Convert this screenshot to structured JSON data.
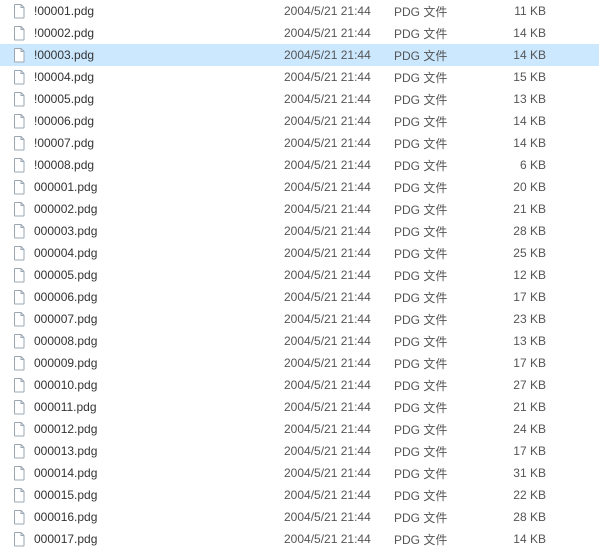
{
  "selectedIndex": 2,
  "files": [
    {
      "name": "!00001.pdg",
      "date": "2004/5/21 21:44",
      "type": "PDG 文件",
      "size": "11 KB"
    },
    {
      "name": "!00002.pdg",
      "date": "2004/5/21 21:44",
      "type": "PDG 文件",
      "size": "14 KB"
    },
    {
      "name": "!00003.pdg",
      "date": "2004/5/21 21:44",
      "type": "PDG 文件",
      "size": "14 KB"
    },
    {
      "name": "!00004.pdg",
      "date": "2004/5/21 21:44",
      "type": "PDG 文件",
      "size": "15 KB"
    },
    {
      "name": "!00005.pdg",
      "date": "2004/5/21 21:44",
      "type": "PDG 文件",
      "size": "13 KB"
    },
    {
      "name": "!00006.pdg",
      "date": "2004/5/21 21:44",
      "type": "PDG 文件",
      "size": "14 KB"
    },
    {
      "name": "!00007.pdg",
      "date": "2004/5/21 21:44",
      "type": "PDG 文件",
      "size": "14 KB"
    },
    {
      "name": "!00008.pdg",
      "date": "2004/5/21 21:44",
      "type": "PDG 文件",
      "size": "6 KB"
    },
    {
      "name": "000001.pdg",
      "date": "2004/5/21 21:44",
      "type": "PDG 文件",
      "size": "20 KB"
    },
    {
      "name": "000002.pdg",
      "date": "2004/5/21 21:44",
      "type": "PDG 文件",
      "size": "21 KB"
    },
    {
      "name": "000003.pdg",
      "date": "2004/5/21 21:44",
      "type": "PDG 文件",
      "size": "28 KB"
    },
    {
      "name": "000004.pdg",
      "date": "2004/5/21 21:44",
      "type": "PDG 文件",
      "size": "25 KB"
    },
    {
      "name": "000005.pdg",
      "date": "2004/5/21 21:44",
      "type": "PDG 文件",
      "size": "12 KB"
    },
    {
      "name": "000006.pdg",
      "date": "2004/5/21 21:44",
      "type": "PDG 文件",
      "size": "17 KB"
    },
    {
      "name": "000007.pdg",
      "date": "2004/5/21 21:44",
      "type": "PDG 文件",
      "size": "23 KB"
    },
    {
      "name": "000008.pdg",
      "date": "2004/5/21 21:44",
      "type": "PDG 文件",
      "size": "13 KB"
    },
    {
      "name": "000009.pdg",
      "date": "2004/5/21 21:44",
      "type": "PDG 文件",
      "size": "17 KB"
    },
    {
      "name": "000010.pdg",
      "date": "2004/5/21 21:44",
      "type": "PDG 文件",
      "size": "27 KB"
    },
    {
      "name": "000011.pdg",
      "date": "2004/5/21 21:44",
      "type": "PDG 文件",
      "size": "21 KB"
    },
    {
      "name": "000012.pdg",
      "date": "2004/5/21 21:44",
      "type": "PDG 文件",
      "size": "24 KB"
    },
    {
      "name": "000013.pdg",
      "date": "2004/5/21 21:44",
      "type": "PDG 文件",
      "size": "17 KB"
    },
    {
      "name": "000014.pdg",
      "date": "2004/5/21 21:44",
      "type": "PDG 文件",
      "size": "31 KB"
    },
    {
      "name": "000015.pdg",
      "date": "2004/5/21 21:44",
      "type": "PDG 文件",
      "size": "22 KB"
    },
    {
      "name": "000016.pdg",
      "date": "2004/5/21 21:44",
      "type": "PDG 文件",
      "size": "28 KB"
    },
    {
      "name": "000017.pdg",
      "date": "2004/5/21 21:44",
      "type": "PDG 文件",
      "size": "14 KB"
    }
  ]
}
